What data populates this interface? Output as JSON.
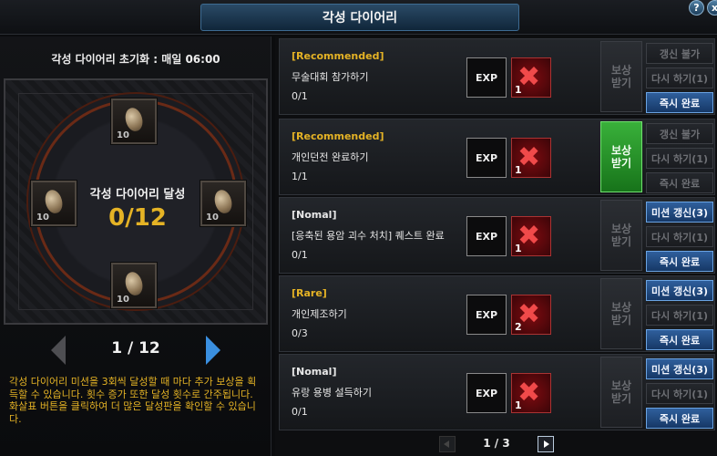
{
  "window": {
    "title": "각성 다이어리",
    "help_icon": "?",
    "close_icon": "x"
  },
  "left": {
    "reset_text": "각성 다이어리 초기화 : 매일 06:00",
    "center_label": "각성 다이어리 달성",
    "center_count": "0/12",
    "slots": [
      {
        "count": "10"
      },
      {
        "count": "10"
      },
      {
        "count": "10"
      },
      {
        "count": "10"
      }
    ],
    "page": "1 / 12",
    "description": "각성 다이어리 미션을 3회씩 달성할 때 마다 추가 보상을 획득할 수 있습니다. 횟수 증가 또한 달성 횟수로 간주됩니다. 화살표 버튼을 클릭하여 더 많은 달성판을 확인할 수 있습니다."
  },
  "missions": [
    {
      "tag": "[Recommended]",
      "tag_color": "#e5b325",
      "name": "무술대회 참가하기",
      "progress": "0/1",
      "exp_label": "EXP",
      "item_count": "1",
      "reward_label": "보상\n받기",
      "reward_active": false,
      "buttons": [
        "갱신 불가",
        "다시 하기(1)",
        "즉시 완료"
      ],
      "buttons_active": [
        false,
        false,
        true
      ]
    },
    {
      "tag": "[Recommended]",
      "tag_color": "#e5b325",
      "name": "개인던전 완료하기",
      "progress": "1/1",
      "exp_label": "EXP",
      "item_count": "1",
      "reward_label": "보상\n받기",
      "reward_active": true,
      "buttons": [
        "갱신 불가",
        "다시 하기(1)",
        "즉시 완료"
      ],
      "buttons_active": [
        false,
        false,
        false
      ]
    },
    {
      "tag": "[Nomal]",
      "tag_color": "#e8e8e8",
      "name": "[응축된 용암 괴수 처치] 퀘스트 완료",
      "progress": "0/1",
      "exp_label": "EXP",
      "item_count": "1",
      "reward_label": "보상\n받기",
      "reward_active": false,
      "buttons": [
        "미션 갱신(3)",
        "다시 하기(1)",
        "즉시 완료"
      ],
      "buttons_active": [
        true,
        false,
        true
      ]
    },
    {
      "tag": "[Rare]",
      "tag_color": "#e5b325",
      "name": "개인제조하기",
      "progress": "0/3",
      "exp_label": "EXP",
      "item_count": "2",
      "reward_label": "보상\n받기",
      "reward_active": false,
      "buttons": [
        "미션 갱신(3)",
        "다시 하기(1)",
        "즉시 완료"
      ],
      "buttons_active": [
        true,
        false,
        true
      ]
    },
    {
      "tag": "[Nomal]",
      "tag_color": "#e8e8e8",
      "name": "유랑 용병 설득하기",
      "progress": "0/1",
      "exp_label": "EXP",
      "item_count": "1",
      "reward_label": "보상\n받기",
      "reward_active": false,
      "buttons": [
        "미션 갱신(3)",
        "다시 하기(1)",
        "즉시 완료"
      ],
      "buttons_active": [
        true,
        false,
        true
      ]
    }
  ],
  "list_pager": {
    "text": "1 / 3"
  }
}
